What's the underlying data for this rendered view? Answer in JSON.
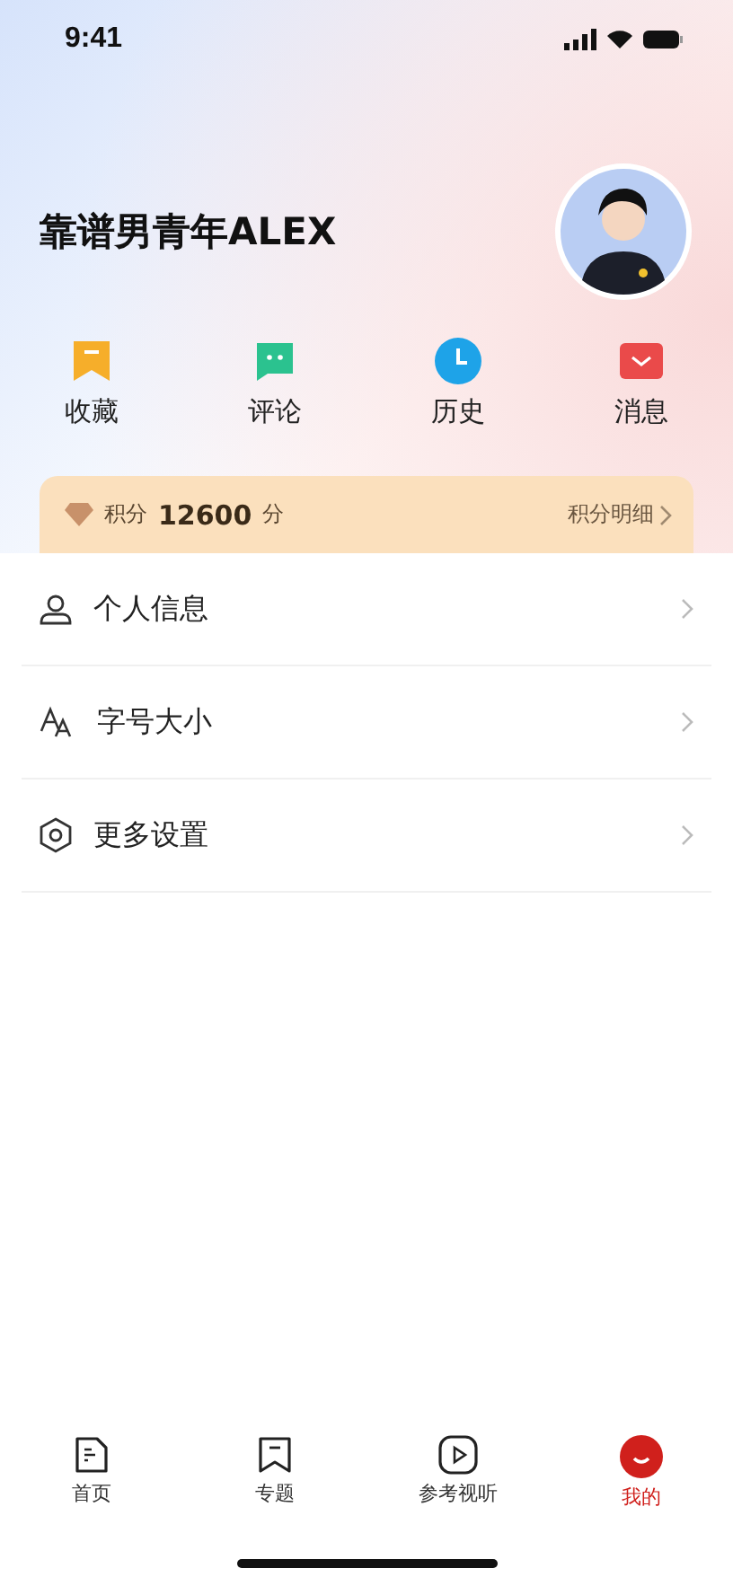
{
  "status_bar": {
    "time": "9:41"
  },
  "profile": {
    "name": "靠谱男青年ALEX"
  },
  "shortcuts": [
    {
      "kind": "bookmark",
      "label": "收藏"
    },
    {
      "kind": "comment",
      "label": "评论"
    },
    {
      "kind": "clock",
      "label": "历史"
    },
    {
      "kind": "mail",
      "label": "消息"
    }
  ],
  "points": {
    "label": "积分",
    "value": "12600",
    "unit": "分",
    "link": "积分明细"
  },
  "menu": [
    {
      "kind": "person",
      "label": "个人信息"
    },
    {
      "kind": "font",
      "label": "字号大小"
    },
    {
      "kind": "settings",
      "label": "更多设置"
    }
  ],
  "tab_bar": [
    {
      "kind": "home",
      "label": "首页",
      "selected": false
    },
    {
      "kind": "topic",
      "label": "专题",
      "selected": false
    },
    {
      "kind": "video",
      "label": "参考视听",
      "selected": false
    },
    {
      "kind": "me",
      "label": "我的",
      "selected": true
    }
  ]
}
